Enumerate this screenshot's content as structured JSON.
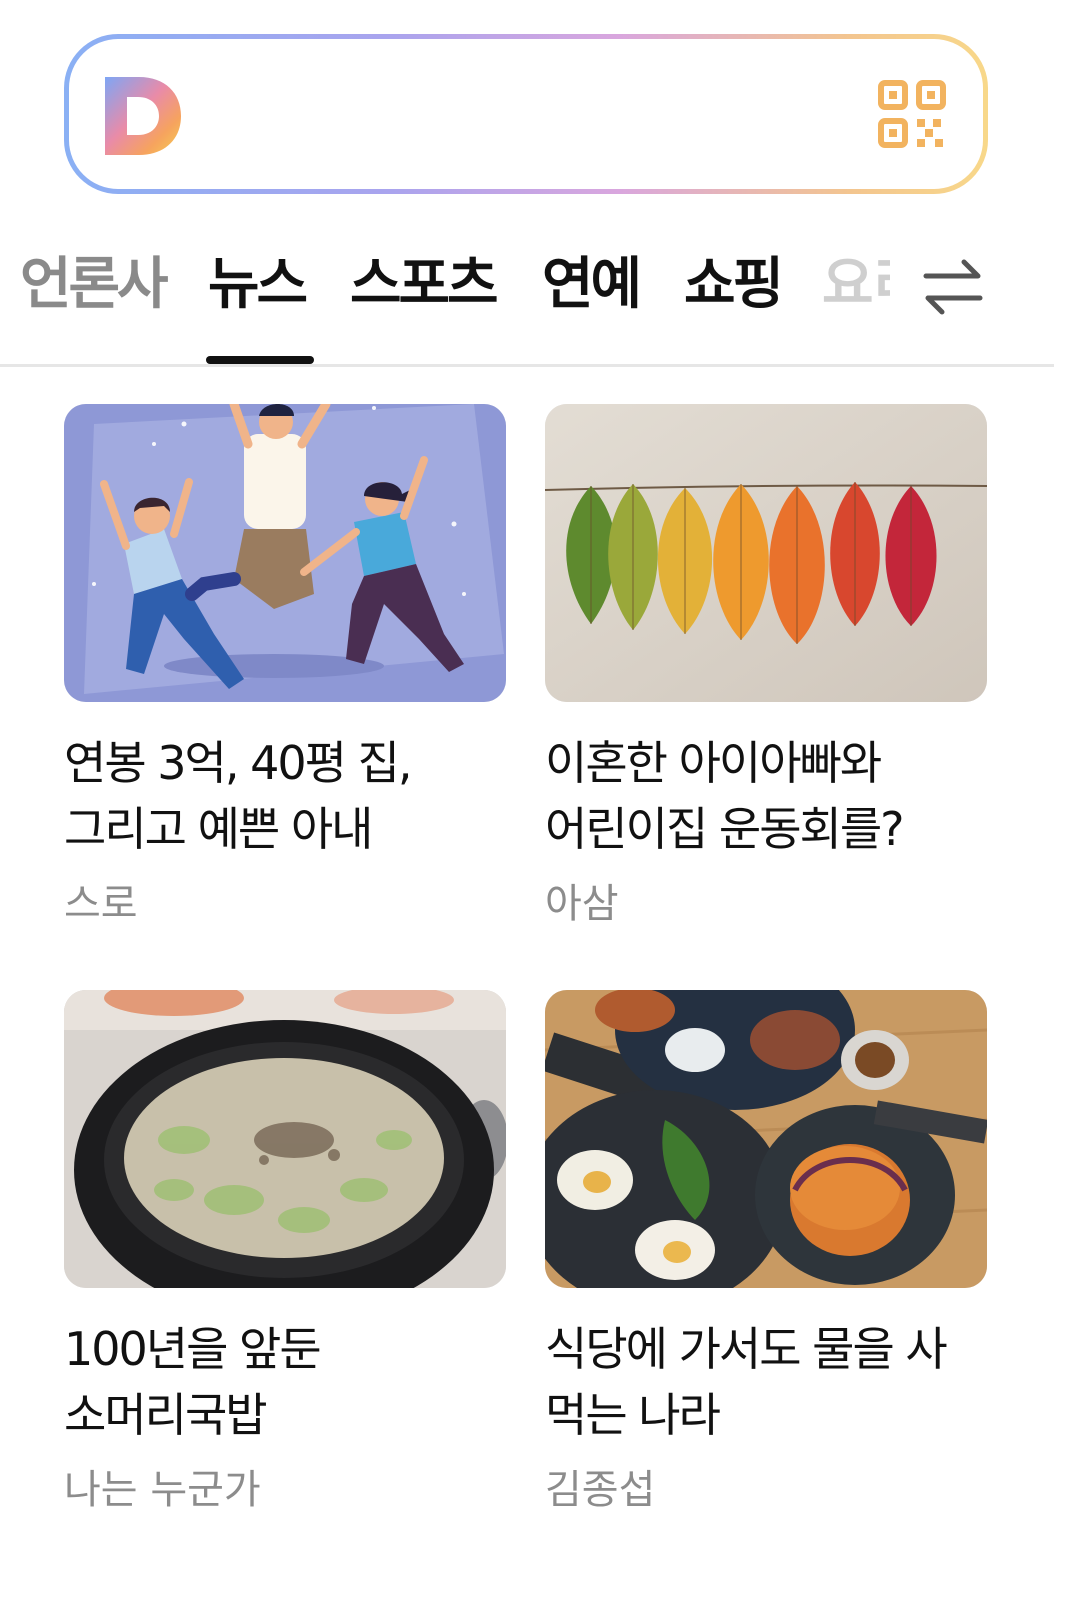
{
  "search": {
    "logo_letter": "D",
    "placeholder": "",
    "value": "",
    "logo_icon": "daum-logo",
    "qr_icon": "qr-code-icon",
    "gradient_colors": [
      "#8ab0f4",
      "#a9a4ee",
      "#d9a6de",
      "#f3c58f",
      "#f8d88a"
    ]
  },
  "tabs": {
    "items": [
      {
        "label": "언론사",
        "faded": true
      },
      {
        "label": "뉴스",
        "selected": true
      },
      {
        "label": "스포츠"
      },
      {
        "label": "연예"
      },
      {
        "label": "쇼핑"
      },
      {
        "label": "요리"
      }
    ],
    "edit_icon": "swap-arrows-icon"
  },
  "cards": [
    {
      "title": "연봉 3억, 40평 집, 그리고 예쁜 아내",
      "author": "스로",
      "thumb": "people-celebrating-illustration"
    },
    {
      "title": "이혼한 아이아빠와 어린이집 운동회를?",
      "author": "아삼",
      "thumb": "autumn-leaves-on-string"
    },
    {
      "title": "100년을 앞둔 소머리국밥",
      "author": "나는 누군가",
      "thumb": "gukbap-bowl"
    },
    {
      "title": "식당에 가서도 물을 사 먹는 나라",
      "author": "김종섭",
      "thumb": "brunch-plates"
    }
  ],
  "colors": {
    "accent": "#111111",
    "muted_text": "#8c8c8c",
    "divider": "#e6e6e6"
  }
}
